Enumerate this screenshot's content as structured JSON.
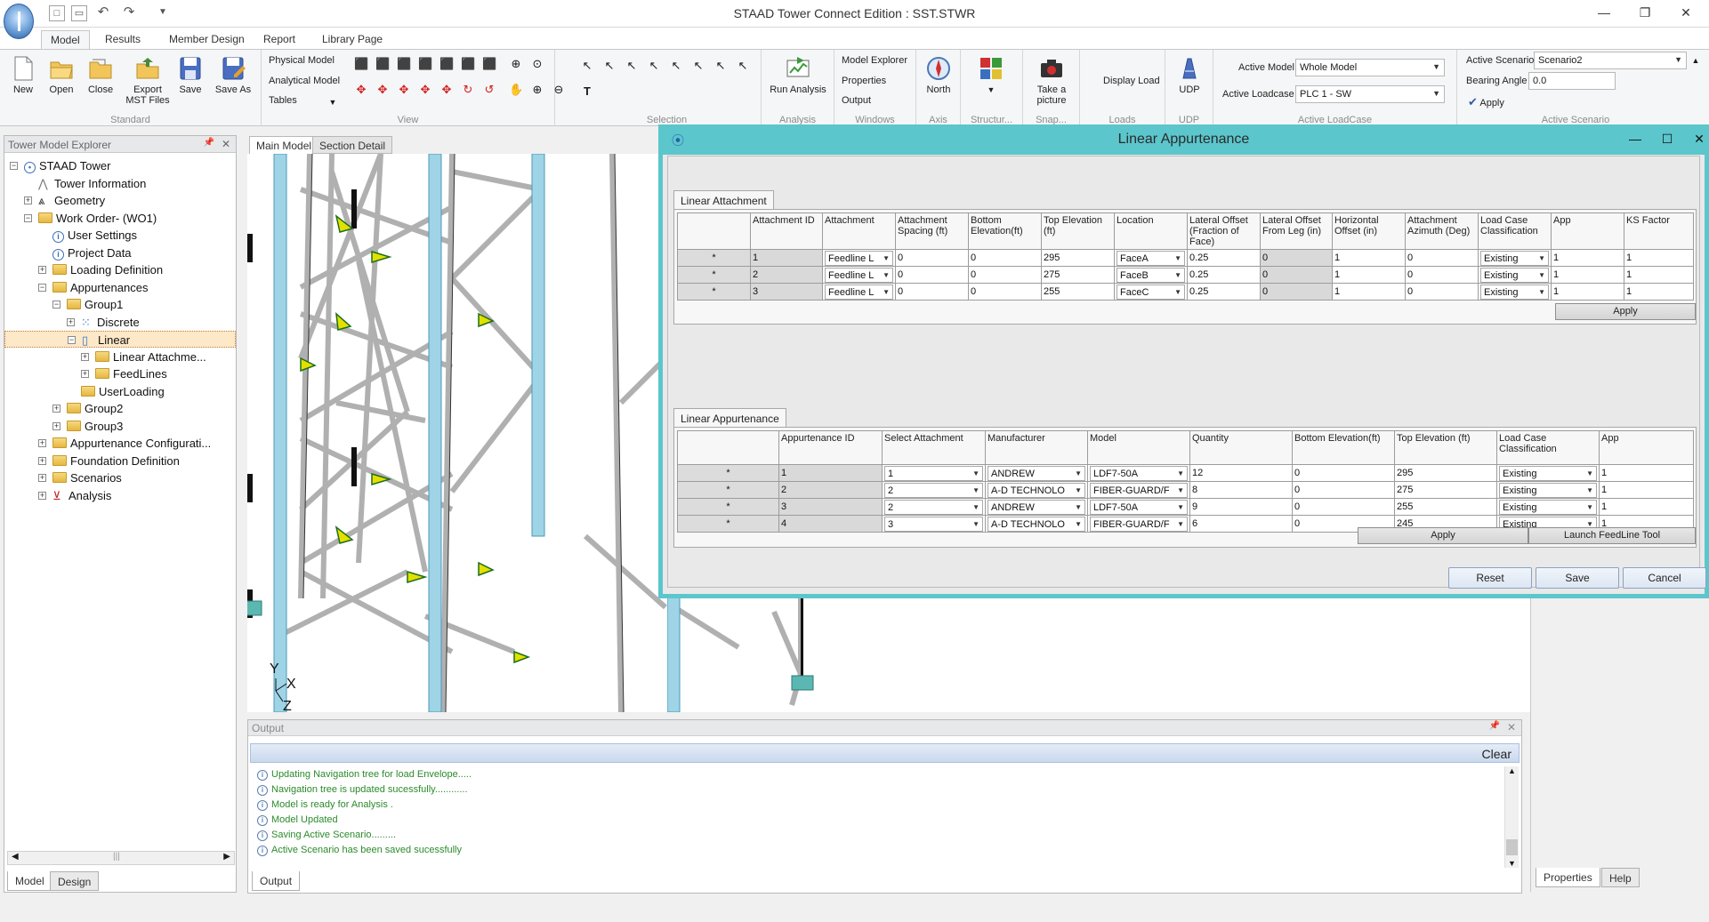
{
  "app": {
    "title": "STAAD Tower Connect Edition : SST.STWR"
  },
  "ribbon_tabs": [
    "Model",
    "Results",
    "Member Design",
    "Report",
    "Library Page"
  ],
  "ribbon": {
    "standard": {
      "label": "Standard",
      "buttons": [
        "New",
        "Open",
        "Close",
        "Export MST Files",
        "Save",
        "Save As"
      ]
    },
    "view": {
      "label": "View",
      "items": [
        "Physical Model",
        "Analytical Model",
        "Tables"
      ]
    },
    "selection": {
      "label": "Selection"
    },
    "analysis": {
      "label": "Analysis",
      "button": "Run Analysis"
    },
    "windows": {
      "label": "Windows",
      "items": [
        "Model Explorer",
        "Properties",
        "Output"
      ]
    },
    "axis": {
      "label": "Axis",
      "button": "North"
    },
    "structure": {
      "label": "Structur..."
    },
    "snap": {
      "label": "Snap...",
      "button": "Take a picture"
    },
    "loads": {
      "label": "Loads",
      "button": "Display Load"
    },
    "udp": {
      "label": "UDP",
      "button": "UDP"
    },
    "active_loadcase": {
      "label": "Active LoadCase",
      "active_model_label": "Active Model",
      "active_model_value": "Whole Model",
      "active_loadcase_label": "Active Loadcase",
      "active_loadcase_value": "PLC 1 - SW"
    },
    "active_scenario": {
      "label": "Active Scenario",
      "scenario_label": "Active Scenario",
      "scenario_value": "Scenario2",
      "bearing_label": "Bearing Angle",
      "bearing_value": "0.0",
      "apply_label": "Apply"
    }
  },
  "explorer": {
    "title": "Tower Model Explorer",
    "items": [
      "STAAD Tower",
      "Tower Information",
      "Geometry",
      "Work Order- (WO1)",
      "User Settings",
      "Project Data",
      "Loading Definition",
      "Appurtenances",
      "Group1",
      "Discrete",
      "Linear",
      "Linear Attachme...",
      "FeedLines",
      "UserLoading",
      "Group2",
      "Group3",
      "Appurtenance Configurati...",
      "Foundation Definition",
      "Scenarios",
      "Analysis"
    ],
    "bottom_tabs": [
      "Model",
      "Design"
    ]
  },
  "doc_tabs": [
    "Main Model",
    "Section Detail"
  ],
  "axes": {
    "y": "Y",
    "x": "X",
    "z": "Z"
  },
  "output": {
    "title": "Output",
    "clear_label": "Clear",
    "tab": "Output",
    "lines": [
      "Updating Navigation tree for load Envelope.....",
      "Navigation tree is updated sucessfully............",
      "Model is ready for Analysis .",
      "Model Updated",
      "Saving Active Scenario.........",
      "Active Scenario has been saved sucessfully"
    ]
  },
  "properties_tabs": [
    "Properties",
    "Help"
  ],
  "dialog": {
    "title": "Linear Appurtenance",
    "attachment": {
      "tab": "Linear Attachment",
      "headers": [
        "Attachment ID",
        "Attachment",
        "Attachment Spacing (ft)",
        "Bottom Elevation(ft)",
        "Top Elevation (ft)",
        "Location",
        "Lateral Offset (Fraction of Face)",
        "Lateral Offset From Leg (in)",
        "Horizontal Offset (in)",
        "Attachment Azimuth (Deg)",
        "Load Case Classification",
        "App",
        "KS Factor"
      ],
      "rows": [
        [
          "1",
          "Feedline L",
          "0",
          "0",
          "295",
          "FaceA",
          "0.25",
          "0",
          "1",
          "0",
          "Existing",
          "1",
          "1"
        ],
        [
          "2",
          "Feedline L",
          "0",
          "0",
          "275",
          "FaceB",
          "0.25",
          "0",
          "1",
          "0",
          "Existing",
          "1",
          "1"
        ],
        [
          "3",
          "Feedline L",
          "0",
          "0",
          "255",
          "FaceC",
          "0.25",
          "0",
          "1",
          "0",
          "Existing",
          "1",
          "1"
        ]
      ],
      "row_marker": "*",
      "apply_label": "Apply"
    },
    "appurtenance": {
      "tab": "Linear Appurtenance",
      "headers": [
        "Appurtenance ID",
        "Select Attachment",
        "Manufacturer",
        "Model",
        "Quantity",
        "Bottom Elevation(ft)",
        "Top Elevation (ft)",
        "Load Case Classification",
        "App"
      ],
      "rows": [
        [
          "1",
          "1",
          "ANDREW",
          "LDF7-50A",
          "12",
          "0",
          "295",
          "Existing",
          "1"
        ],
        [
          "2",
          "2",
          "A-D TECHNOLO",
          "FIBER-GUARD/F",
          "8",
          "0",
          "275",
          "Existing",
          "1"
        ],
        [
          "3",
          "2",
          "ANDREW",
          "LDF7-50A",
          "9",
          "0",
          "255",
          "Existing",
          "1"
        ],
        [
          "4",
          "3",
          "A-D TECHNOLO",
          "FIBER-GUARD/F",
          "6",
          "0",
          "245",
          "Existing",
          "1"
        ]
      ],
      "row_marker": "*",
      "apply_label": "Apply",
      "launch_label": "Launch FeedLine Tool"
    },
    "buttons": {
      "reset": "Reset",
      "save": "Save",
      "cancel": "Cancel"
    }
  },
  "colors": {
    "dialog_accent": "#5bc6cc",
    "output_text": "#2b8a2b",
    "tower_member": "#b0b0b0",
    "brace_accent": "#e3e000",
    "brace_node": "#1d6e1d"
  }
}
